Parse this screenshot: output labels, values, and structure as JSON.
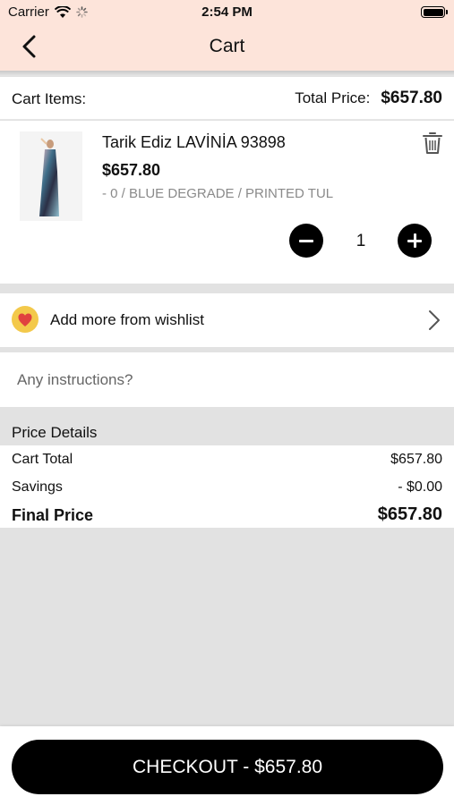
{
  "status_bar": {
    "carrier": "Carrier",
    "time": "2:54 PM"
  },
  "nav": {
    "title": "Cart",
    "back_icon": "chevron-left-icon"
  },
  "cart": {
    "items_label": "Cart Items:",
    "total_label": "Total Price:",
    "total_value": "$657.80"
  },
  "item": {
    "name": "Tarik Ediz LAVİNİA 93898",
    "price": "$657.80",
    "variant": "- 0 / BLUE DEGRADE / PRINTED TUL",
    "quantity": "1",
    "thumb_colors": [
      "#f2bfc8",
      "#3f6f8a",
      "#2b2f45",
      "#e9c8a6"
    ]
  },
  "wishlist": {
    "label": "Add more from wishlist",
    "icon": "heart-icon",
    "icon_color": "#f3c94b",
    "heart_color": "#e0413f"
  },
  "instructions": {
    "placeholder": "Any instructions?"
  },
  "price_details": {
    "heading": "Price Details",
    "cart_total_label": "Cart Total",
    "cart_total_value": "$657.80",
    "savings_label": "Savings",
    "savings_value": "- $0.00",
    "final_label": "Final Price",
    "final_value": "$657.80"
  },
  "checkout": {
    "label": "CHECKOUT - $657.80"
  },
  "colors": {
    "header_bg": "#fde4da",
    "page_bg": "#e2e2e2",
    "button_bg": "#000000"
  }
}
